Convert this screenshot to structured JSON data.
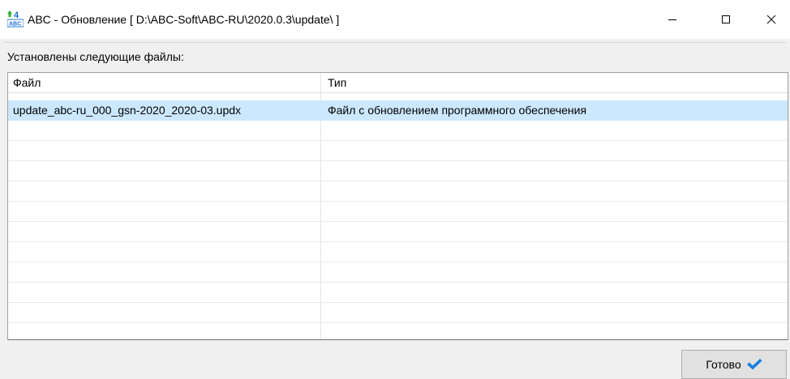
{
  "window": {
    "title": "ABC - Обновление [ D:\\ABC-Soft\\ABC-RU\\2020.0.3\\update\\ ]",
    "app_icon_text": "4",
    "app_icon_sub": "ABC",
    "icons": {
      "app": "abc-app-icon",
      "minimize": "minimize-icon",
      "maximize": "maximize-icon",
      "close": "close-icon"
    }
  },
  "header": {
    "label": "Установлены следующие файлы:"
  },
  "table": {
    "columns": [
      "Файл",
      "Тип"
    ],
    "rows": [
      {
        "file": "update_abc-ru_000_gsn-2020_2020-03.updx",
        "type": "Файл с обновлением программного обеспечения"
      }
    ],
    "selected_row": 0,
    "selection_color": "#cce8ff"
  },
  "footer": {
    "done_label": "Готово",
    "done_icon": "checkmark-icon",
    "accent_color": "#1a7fe0"
  }
}
